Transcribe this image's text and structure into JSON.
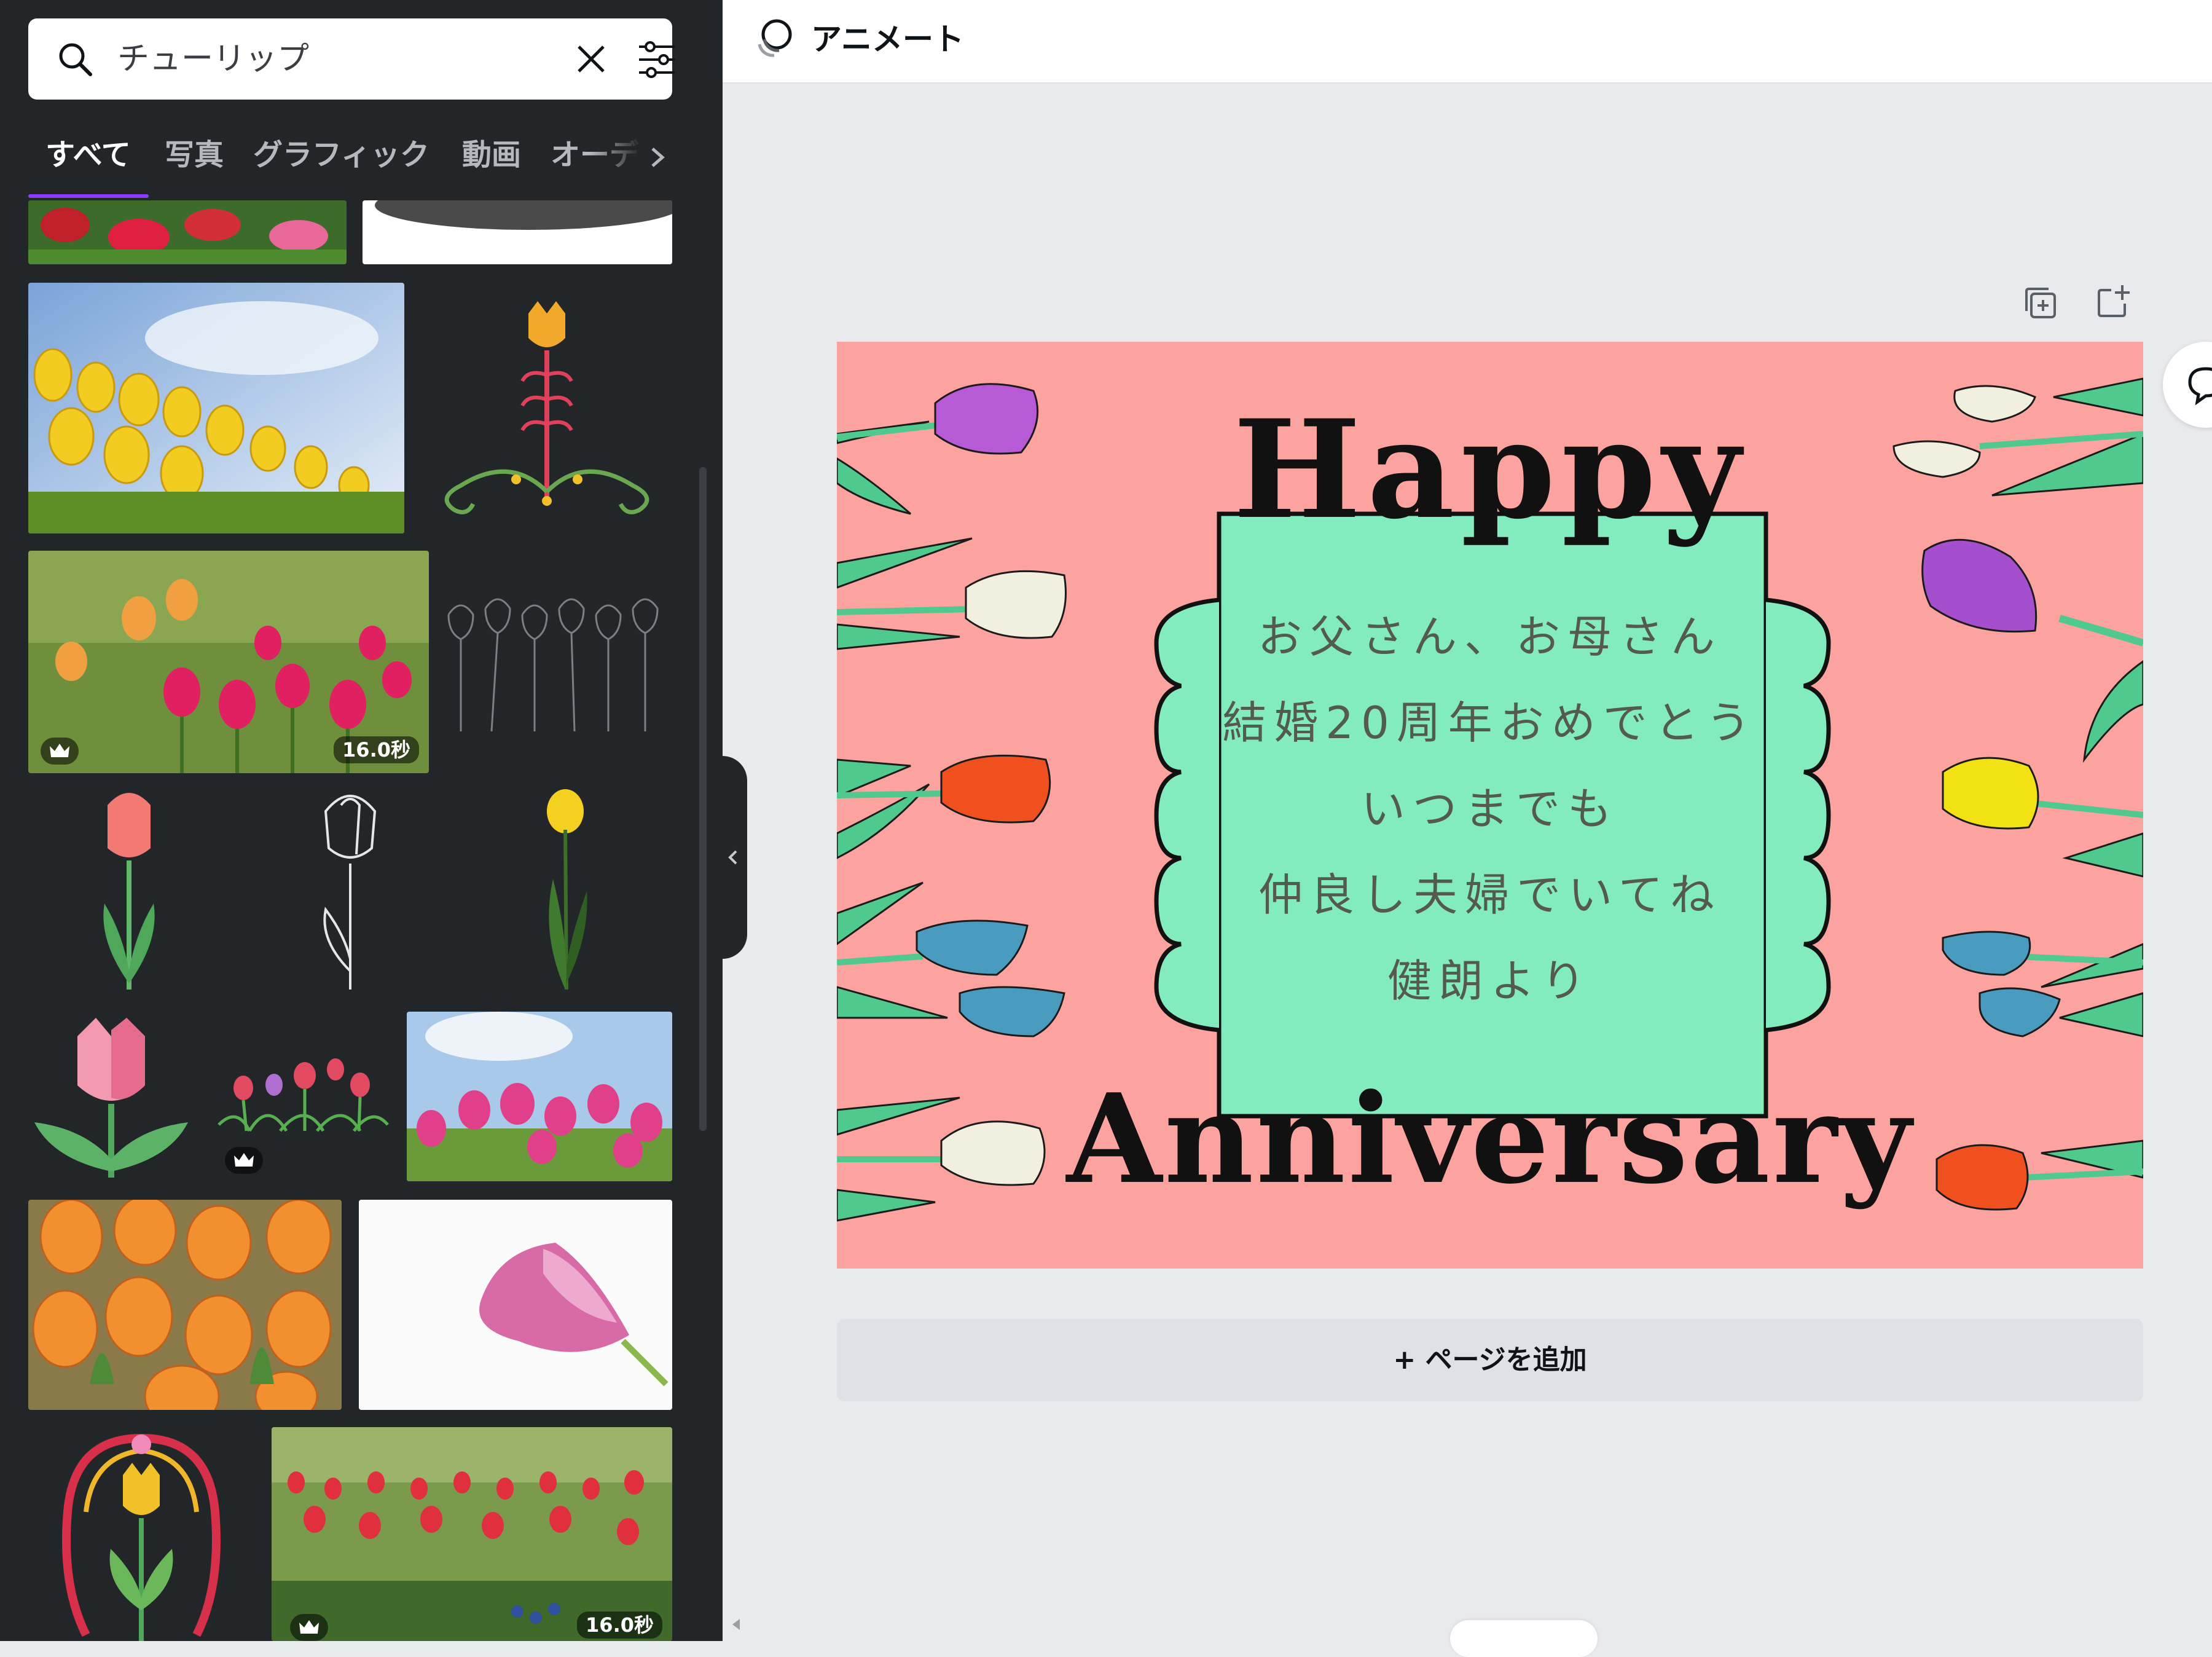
{
  "search": {
    "query": "チューリップ"
  },
  "tabs": [
    {
      "label": "すべて",
      "active": true
    },
    {
      "label": "写真"
    },
    {
      "label": "グラフィック"
    },
    {
      "label": "動画"
    },
    {
      "label": "オーデ"
    }
  ],
  "results": {
    "badges": {
      "video1": "16.0秒",
      "video2": "16.0秒"
    }
  },
  "topbar": {
    "animate_label": "アニメート"
  },
  "design": {
    "title_top": "Happy",
    "title_bottom": "Anniversary",
    "message": [
      "お父さん、お母さん",
      "結婚20周年おめでとう",
      "いつまでも",
      "仲良し夫婦でいてね",
      "健朗より"
    ],
    "colors": {
      "background": "#fda39f",
      "frame": "#82ecbf"
    }
  },
  "add_page_label": "+ ページを追加",
  "colors": {
    "panel": "#232629",
    "accent": "#8b3dff",
    "canvas": "#e8eaed"
  }
}
